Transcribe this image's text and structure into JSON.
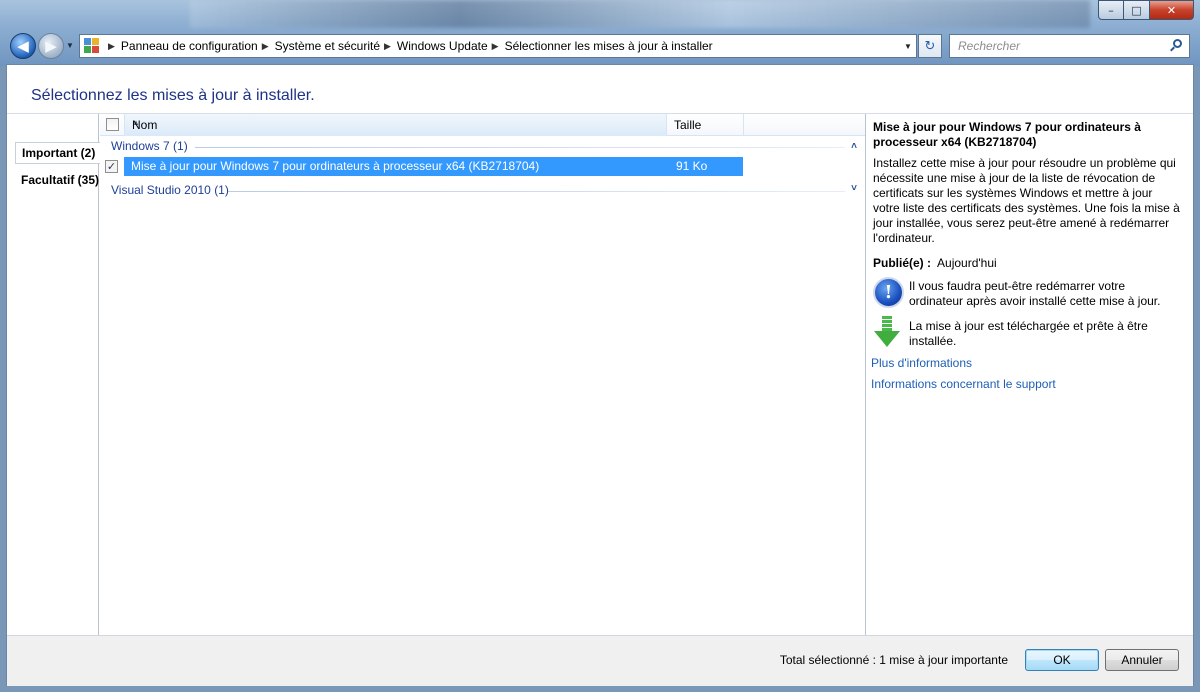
{
  "window": {
    "caption_buttons": {
      "minimize": "–",
      "maximize": "□",
      "close": "✕"
    }
  },
  "nav": {
    "back_glyph": "◀",
    "forward_glyph": "▶",
    "breadcrumbs": [
      "Panneau de configuration",
      "Système et sécurité",
      "Windows Update",
      "Sélectionner les mises à jour à installer"
    ],
    "refresh_glyph": "↻",
    "search_placeholder": "Rechercher"
  },
  "page": {
    "title": "Sélectionnez les mises à jour à installer."
  },
  "categories": {
    "important": "Important (2)",
    "optional": "Facultatif (35)"
  },
  "list": {
    "columns": {
      "name": "Nom",
      "size": "Taille"
    },
    "groups": [
      {
        "label": "Windows 7 (1)",
        "chevron": "˄",
        "expanded": true
      },
      {
        "label": "Visual Studio 2010 (1)",
        "chevron": "˅",
        "expanded": false
      }
    ],
    "rows": [
      {
        "checked": true,
        "check_glyph": "✓",
        "name": "Mise à jour pour Windows 7 pour ordinateurs à processeur x64 (KB2718704)",
        "size": "91 Ko",
        "selected": true
      }
    ]
  },
  "detail": {
    "title": "Mise à jour pour Windows 7 pour ordinateurs à processeur x64 (KB2718704)",
    "description": "Installez cette mise à jour pour résoudre un problème qui nécessite une mise à jour de la liste de révocation de certificats sur les systèmes Windows et mettre à jour votre liste des certificats des systèmes. Une fois la mise à jour installée, vous serez peut-être amené à redémarrer l'ordinateur.",
    "published_label": "Publié(e) :",
    "published_value": "Aujourd'hui",
    "restart_note": "Il vous faudra peut-être redémarrer votre ordinateur après avoir installé cette mise à jour.",
    "info_glyph": "!",
    "download_note": "La mise à jour est téléchargée et prête à être installée.",
    "link_more": "Plus d'informations",
    "link_support": "Informations concernant le support"
  },
  "footer": {
    "total": "Total sélectionné : 1 mise à jour importante",
    "ok": "OK",
    "cancel": "Annuler"
  },
  "colors": {
    "title_blue": "#1e3287",
    "link_blue": "#1e5fb5",
    "selection": "#3399ff",
    "group_blue": "#1e3f9a"
  }
}
